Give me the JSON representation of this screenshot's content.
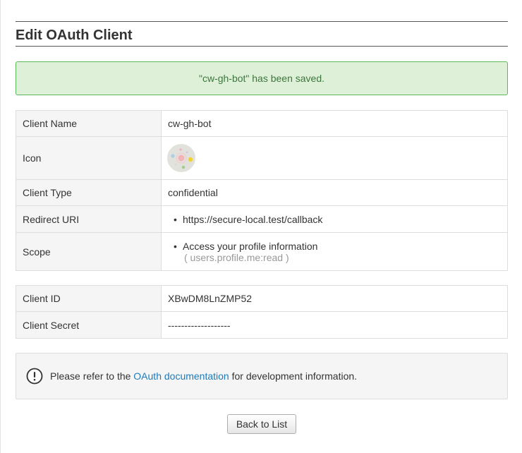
{
  "page": {
    "title": "Edit OAuth Client"
  },
  "alert": {
    "message": "\"cw-gh-bot\" has been saved."
  },
  "client_details": {
    "name_label": "Client Name",
    "name_value": "cw-gh-bot",
    "icon_label": "Icon",
    "icon_name": "app-logo-icon",
    "type_label": "Client Type",
    "type_value": "confidential",
    "redirect_label": "Redirect URI",
    "redirect_uris": [
      "https://secure-local.test/callback"
    ],
    "scope_label": "Scope",
    "scopes": [
      {
        "description": "Access your profile information",
        "code": "( users.profile.me:read )"
      }
    ]
  },
  "credentials": {
    "id_label": "Client ID",
    "id_value": "XBwDM8LnZMP52",
    "secret_label": "Client Secret",
    "secret_value": "-------------------"
  },
  "notice": {
    "icon_name": "exclamation-circle-icon",
    "text_before": "Please refer to the ",
    "link_text": "OAuth documentation",
    "text_after": " for development information."
  },
  "actions": {
    "back_label": "Back to List"
  },
  "colors": {
    "alert_bg": "#dff0d8",
    "alert_border": "#5cb85c",
    "alert_text": "#3c763d",
    "link": "#1e7ab8",
    "label_bg": "#f5f5f5"
  }
}
